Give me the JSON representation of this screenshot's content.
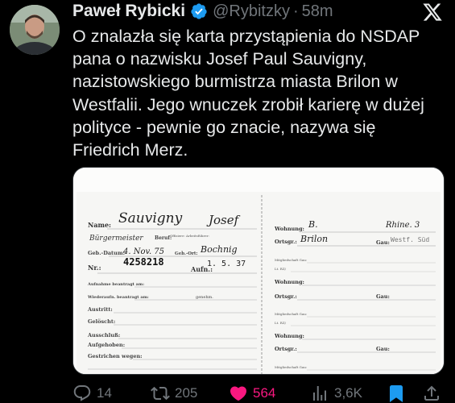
{
  "author": {
    "name": "Paweł Rybicki",
    "handle": "@Rybitzky",
    "separator": "·",
    "time": "58m"
  },
  "tweet_text": "O znalazła się karta przystąpienia do NSDAP pana o nazwisku Josef Paul Sauvigny, nazistowskiego burmistrza miasta Brilon w Westfalii. Jego wnuczek zrobił karierę w dużej polityce - pewnie go znacie, nazywa się Friedrich Merz.",
  "card": {
    "name_label": "Name:",
    "surname": "Sauvigny",
    "first_name": "Josef",
    "occupation_handwritten": "Bürgermeister",
    "beruf_label": "Beruf:",
    "beruf_note": "Offiziere: Arbeitsführer:",
    "birth_label": "Geb.-Datum:",
    "birth_date": "4. Nov. 75",
    "birthplace_label": "Geb.-Ort:",
    "birthplace": "Bochnig",
    "nr_label": "Nr.:",
    "member_number": "4258218",
    "aufn_label": "Aufn.:",
    "aufn_date": "1. 5. 37",
    "left_rows": [
      "Aufnahme beantragt am:",
      "Wiederaufn. beantragt am:",
      "Austritt:",
      "Gelöscht:",
      "Ausschluß:",
      "Aufgehoben:",
      "Gestrichen wegen:"
    ],
    "left_row2_suffix": "genehm.",
    "right_wohnung_label": "Wohnung:",
    "right_wohnung_value": "B.",
    "right_street": "Rhine. 3",
    "right_ortsgr_label": "Ortsgr.:",
    "right_ortsgr_value": "Brilon",
    "right_gau_label": "Gau:",
    "right_gau_value": "Westf. Süd",
    "right_small_rows": [
      "Mitgliedschaft Gau:",
      "Lt. RZ/"
    ],
    "right_blocks": [
      "Wohnung:",
      "Ortsgr.:",
      "Gau:"
    ]
  },
  "actions": {
    "replies": "14",
    "reposts": "205",
    "likes": "564",
    "views": "3,6K"
  },
  "colors": {
    "background": "#000000",
    "text": "#e7e9ea",
    "muted": "#71767b",
    "verified": "#1d9bf0",
    "like": "#f91880",
    "bookmark": "#1d9bf0"
  },
  "icons": [
    "verified-badge-icon",
    "x-logo-icon",
    "reply-icon",
    "repost-icon",
    "like-heart-icon",
    "views-icon",
    "bookmark-icon",
    "share-icon"
  ]
}
